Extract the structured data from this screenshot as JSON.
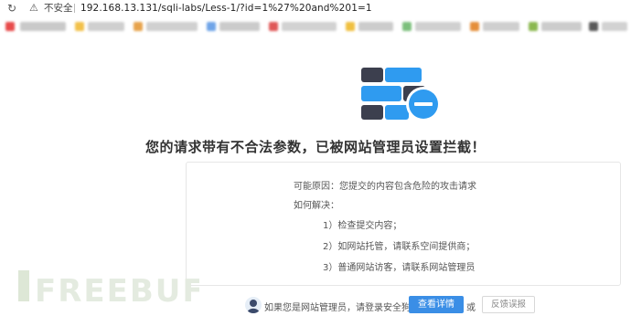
{
  "address_bar": {
    "security_label": "不安全",
    "url": "192.168.13.131/sqli-labs/Less-1/?id=1%27%20and%201=1"
  },
  "main": {
    "title": "您的请求带有不合法参数，已被网站管理员设置拦截！",
    "reason_line": "可能原因：您提交的内容包含危险的攻击请求",
    "howto_label": "如何解决：",
    "steps": [
      "1）检查提交内容；",
      "2）如网站托管，请联系空间提供商；",
      "3）普通网站访客，请联系网站管理员"
    ]
  },
  "footer": {
    "admin_text": "如果您是网站管理员，请登录安全狗",
    "details_button": "查看详情",
    "or_text": "或",
    "report_button": "反馈误报"
  },
  "watermark": "FREEBUF",
  "colors": {
    "primary_blue": "#3a8ee6",
    "wall_blue": "#2f9bf0",
    "wall_dark": "#3c3f4e"
  }
}
